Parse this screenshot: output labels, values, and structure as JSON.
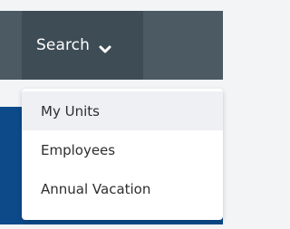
{
  "navbar": {
    "search_label": "Search",
    "chevron_icon": "chevron-down-icon"
  },
  "dropdown": {
    "items": [
      {
        "label": "My Units"
      },
      {
        "label": "Employees"
      },
      {
        "label": "Annual Vacation"
      }
    ]
  },
  "colors": {
    "navbar_bg": "#4b5a63",
    "search_bg": "#3e4c55",
    "content_band": "#0c4a8a",
    "dropdown_bg": "#ffffff",
    "dropdown_active_bg": "#eef0f3"
  }
}
